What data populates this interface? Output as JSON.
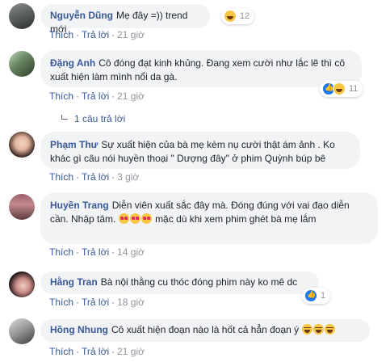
{
  "actions": {
    "like": "Thích",
    "reply": "Trả lời",
    "separator": "·"
  },
  "comments": [
    {
      "author": "Nguyễn Dũng",
      "text": "Mẹ đây =)) trend mới",
      "time": "21 giờ",
      "reactions": {
        "icons": [
          "haha-icon"
        ],
        "count": "12"
      }
    },
    {
      "author": "Đặng Anh",
      "text": "Cô đóng đạt kinh khủng. Đang xem cười như lắc lẽ thì cô xuất hiện làm mình nổi da gà.",
      "time": "21 giờ",
      "reactions": {
        "icons": [
          "like-icon",
          "haha-icon"
        ],
        "count": "11"
      },
      "replies": "1 câu trả lời"
    },
    {
      "author": "Phạm Thư",
      "text": "Sự xuất hiện của bà mẹ kèm nụ cười thật ám ảnh . Ko khác gì câu nói huyền thoại \" Dượng đây\" ở phim Quỳnh búp bê",
      "time": "3 giờ"
    },
    {
      "author": "Huyền Trang",
      "text_before": "Diễn viên xuất sắc đây mà. Đóng đúng với vai đạo diễn cần. Nhập tâm.",
      "text_after": "mặc dù khi xem phim ghét bà mẹ lắm",
      "time": "14 giờ",
      "inline_emoji": [
        "heart-eyes-emoji",
        "heart-eyes-emoji",
        "heart-eyes-emoji"
      ]
    },
    {
      "author": "Hằng Tran",
      "text": "Bà nội thằng cu thóc đóng phim này ko mê dc",
      "time": "18 giờ",
      "reactions": {
        "icons": [
          "like-icon"
        ],
        "count": "1"
      }
    },
    {
      "author": "Hồng Nhung",
      "text": "Cô xuất hiện đoạn nào là hốt cả hẳn đoạn ý",
      "time": "21 giờ",
      "inline_emoji": [
        "laughing-emoji",
        "laughing-emoji",
        "laughing-emoji"
      ]
    }
  ]
}
